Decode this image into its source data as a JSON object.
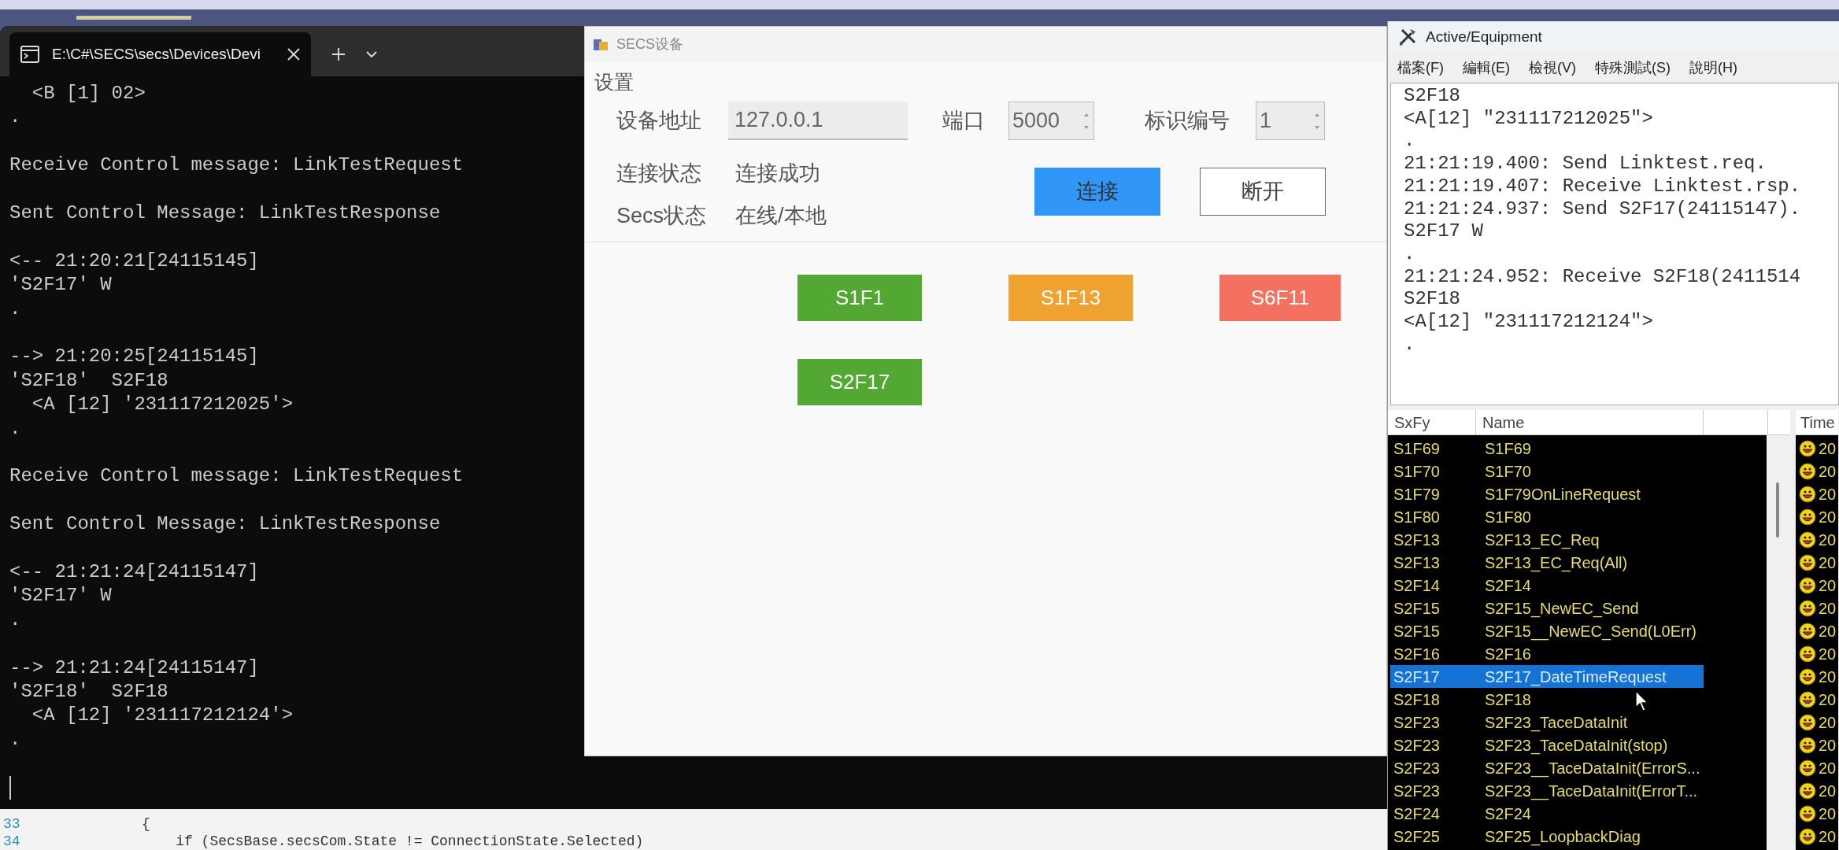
{
  "terminal": {
    "tab_title": "E:\\C#\\SECS\\secs\\Devices\\Devi",
    "blocks": [
      [
        "  <B [1] 02>",
        "."
      ],
      [
        "Receive Control message: LinkTestRequest"
      ],
      [
        "Sent Control Message: LinkTestResponse"
      ],
      [
        "<-- 21:20:21[24115145]",
        "'S2F17' W",
        "."
      ],
      [
        "--> 21:20:25[24115145]",
        "'S2F18'  S2F18",
        "  <A [12] '231117212025'>",
        "."
      ],
      [
        "Receive Control message: LinkTestRequest"
      ],
      [
        "Sent Control Message: LinkTestResponse"
      ],
      [
        "<-- 21:21:24[24115147]",
        "'S2F17' W",
        "."
      ],
      [
        "--> 21:21:24[24115147]",
        "'S2F18'  S2F18",
        "  <A [12] '231117212124'>",
        "."
      ]
    ]
  },
  "editor": {
    "lines": [
      {
        "number": "33",
        "text": "{"
      },
      {
        "number": "34",
        "text": "    if (SecsBase.secsCom.State != ConnectionState.Selected)"
      }
    ]
  },
  "device_window": {
    "title": "SECS设备",
    "group_title": "设置",
    "fields": [
      {
        "label": "设备地址",
        "value": "127.0.0.1",
        "kind": "text",
        "disabled": true
      },
      {
        "label": "端口",
        "value": "5000",
        "kind": "spinner",
        "disabled": true
      },
      {
        "label": "标识编号",
        "value": "1",
        "kind": "spinner",
        "disabled": true
      }
    ],
    "status": [
      {
        "label": "连接状态",
        "value": "连接成功"
      },
      {
        "label": "Secs状态",
        "value": "在线/本地"
      }
    ],
    "buttons": [
      {
        "label": "连接",
        "kind": "primary"
      },
      {
        "label": "断开",
        "kind": "outline"
      }
    ],
    "message_buttons": [
      {
        "label": "S1F1",
        "color": "#52a832"
      },
      {
        "label": "S1F13",
        "color": "#efa22f"
      },
      {
        "label": "S6F11",
        "color": "#f4705f"
      },
      {
        "label": "S2F17",
        "color": "#52a832"
      }
    ]
  },
  "equipment_window": {
    "title": "Active/Equipment",
    "menu": [
      "檔案(F)",
      "編輯(E)",
      "檢視(V)",
      "特殊測試(S)",
      "說明(H)"
    ],
    "log": [
      "S2F18",
      "<A[12] \"231117212025\">",
      ".",
      "21:21:19.400: Send Linktest.req.",
      "21:21:19.407: Receive Linktest.rsp.",
      "21:21:24.937: Send S2F17(24115147).",
      "S2F17 W",
      ".",
      "21:21:24.952: Receive S2F18(2411514",
      "S2F18",
      "<A[12] \"231117212124\">",
      "."
    ],
    "message_list": {
      "columns": [
        "SxFy",
        "Name"
      ],
      "rows": [
        {
          "sxfy": "S1F69",
          "name": "S1F69",
          "selected": false
        },
        {
          "sxfy": "S1F70",
          "name": "S1F70",
          "selected": false
        },
        {
          "sxfy": "S1F79",
          "name": "S1F79OnLineRequest",
          "selected": false
        },
        {
          "sxfy": "S1F80",
          "name": "S1F80",
          "selected": false
        },
        {
          "sxfy": "S2F13",
          "name": "S2F13_EC_Req",
          "selected": false
        },
        {
          "sxfy": "S2F13",
          "name": "S2F13_EC_Req(All)",
          "selected": false
        },
        {
          "sxfy": "S2F14",
          "name": "S2F14",
          "selected": false
        },
        {
          "sxfy": "S2F15",
          "name": "S2F15_NewEC_Send",
          "selected": false
        },
        {
          "sxfy": "S2F15",
          "name": "S2F15__NewEC_Send(L0Err)",
          "selected": false
        },
        {
          "sxfy": "S2F16",
          "name": "S2F16",
          "selected": false
        },
        {
          "sxfy": "S2F17",
          "name": "S2F17_DateTimeRequest",
          "selected": true
        },
        {
          "sxfy": "S2F18",
          "name": "S2F18",
          "selected": false
        },
        {
          "sxfy": "S2F23",
          "name": "S2F23_TaceDataInit",
          "selected": false
        },
        {
          "sxfy": "S2F23",
          "name": "S2F23_TaceDataInit(stop)",
          "selected": false
        },
        {
          "sxfy": "S2F23",
          "name": "S2F23__TaceDataInit(ErrorS...",
          "selected": false
        },
        {
          "sxfy": "S2F23",
          "name": "S2F23__TaceDataInit(ErrorT...",
          "selected": false
        },
        {
          "sxfy": "S2F24",
          "name": "S2F24",
          "selected": false
        },
        {
          "sxfy": "S2F25",
          "name": "S2F25_LoopbackDiag",
          "selected": false
        }
      ]
    },
    "time_list": {
      "header": "Time",
      "rows": [
        "20",
        "20",
        "20",
        "20",
        "20",
        "20",
        "20",
        "20",
        "20",
        "20",
        "20",
        "20",
        "20",
        "20",
        "20",
        "20",
        "20",
        "20"
      ]
    }
  }
}
